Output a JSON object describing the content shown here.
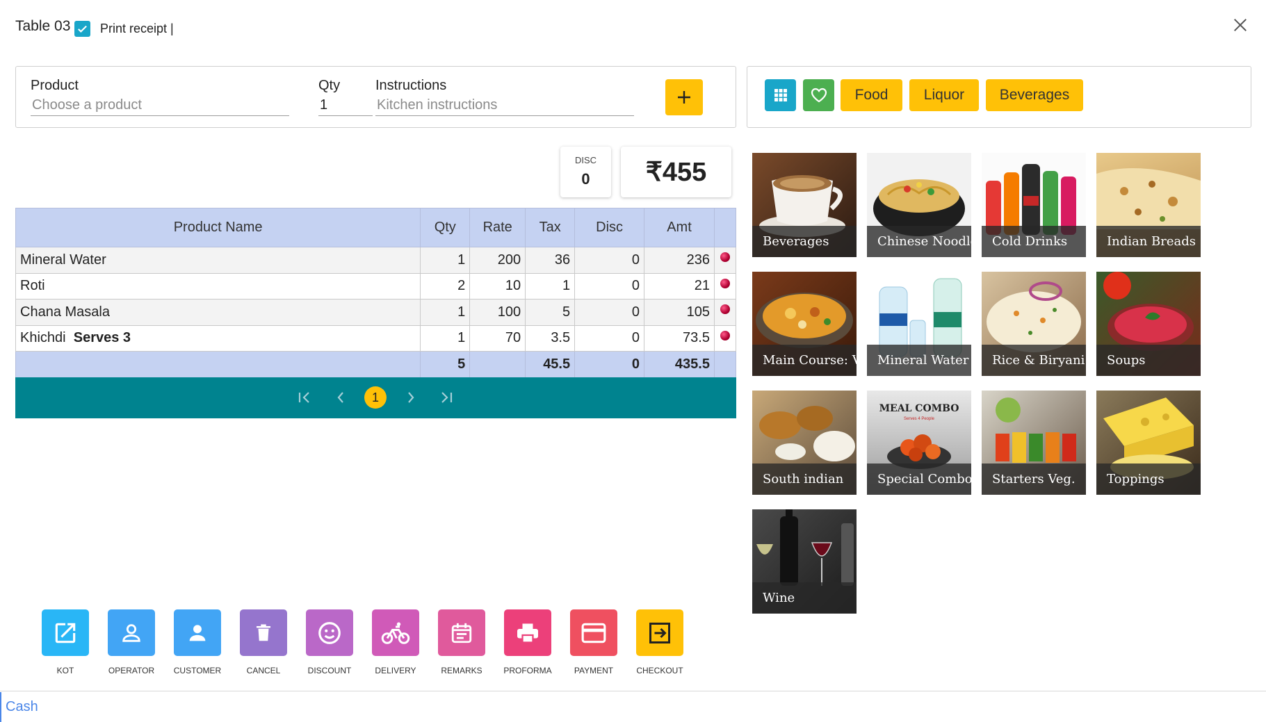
{
  "header": {
    "title": "Table 03",
    "print_receipt_label": "Print receipt |",
    "print_receipt_checked": true
  },
  "entry": {
    "product_label": "Product",
    "product_placeholder": "Choose a product",
    "qty_label": "Qty",
    "qty_value": "1",
    "instructions_label": "Instructions",
    "instructions_placeholder": "Kitchen instructions"
  },
  "categories": {
    "icon_buttons": [
      {
        "icon": "grid-icon",
        "color": "#19a6c9"
      },
      {
        "icon": "heart-icon",
        "color": "#4caf50"
      }
    ],
    "buttons": [
      "Food",
      "Liquor",
      "Beverages"
    ]
  },
  "summary": {
    "disc_label": "DISC",
    "disc_value": "0",
    "total": "₹455"
  },
  "table": {
    "headers": [
      "Product Name",
      "Qty",
      "Rate",
      "Tax",
      "Disc",
      "Amt",
      ""
    ],
    "rows": [
      {
        "name": "Mineral Water",
        "note": "",
        "qty": "1",
        "rate": "200",
        "tax": "36",
        "disc": "0",
        "amt": "236"
      },
      {
        "name": "Roti",
        "note": "",
        "qty": "2",
        "rate": "10",
        "tax": "1",
        "disc": "0",
        "amt": "21"
      },
      {
        "name": "Chana Masala",
        "note": "",
        "qty": "1",
        "rate": "100",
        "tax": "5",
        "disc": "0",
        "amt": "105"
      },
      {
        "name": "Khichdi",
        "note": "Serves 3",
        "qty": "1",
        "rate": "70",
        "tax": "3.5",
        "disc": "0",
        "amt": "73.5"
      }
    ],
    "totals": {
      "qty": "5",
      "tax": "45.5",
      "disc": "0",
      "amt": "435.5"
    }
  },
  "pager": {
    "current_page": "1"
  },
  "tiles": [
    {
      "label": "Beverages",
      "art": "coffee"
    },
    {
      "label": "Chinese Noodles",
      "art": "noodles"
    },
    {
      "label": "Cold Drinks",
      "art": "bottles"
    },
    {
      "label": "Indian Breads",
      "art": "bread"
    },
    {
      "label": "Main Course: Veg",
      "art": "curry"
    },
    {
      "label": "Mineral Water",
      "art": "water"
    },
    {
      "label": "Rice & Biryani",
      "art": "rice"
    },
    {
      "label": "Soups",
      "art": "soup"
    },
    {
      "label": "South indian",
      "art": "south"
    },
    {
      "label": "Special Combos",
      "art": "combo",
      "overlay_title": "MEAL COMBO",
      "overlay_sub": "Serves 4 People"
    },
    {
      "label": "Starters Veg.",
      "art": "starters"
    },
    {
      "label": "Toppings",
      "art": "cheese"
    },
    {
      "label": "Wine",
      "art": "wine"
    }
  ],
  "actions": [
    {
      "label": "KOT",
      "icon": "open-external-icon",
      "color": "#29b6f6"
    },
    {
      "label": "OPERATOR",
      "icon": "user-outline-icon",
      "color": "#42a5f5"
    },
    {
      "label": "CUSTOMER",
      "icon": "user-icon",
      "color": "#42a5f5"
    },
    {
      "label": "CANCEL",
      "icon": "trash-icon",
      "color": "#9575cd"
    },
    {
      "label": "DISCOUNT",
      "icon": "smile-icon",
      "color": "#ba68c8"
    },
    {
      "label": "DELIVERY",
      "icon": "bicycle-icon",
      "color": "#d05ab8"
    },
    {
      "label": "REMARKS",
      "icon": "calendar-icon",
      "color": "#e05a9c"
    },
    {
      "label": "PROFORMA",
      "icon": "printer-icon",
      "color": "#ec407a"
    },
    {
      "label": "PAYMENT",
      "icon": "card-icon",
      "color": "#ef5060"
    },
    {
      "label": "CHECKOUT",
      "icon": "exit-icon",
      "color": "#ffc107"
    }
  ],
  "footer": {
    "payment_mode": "Cash"
  }
}
